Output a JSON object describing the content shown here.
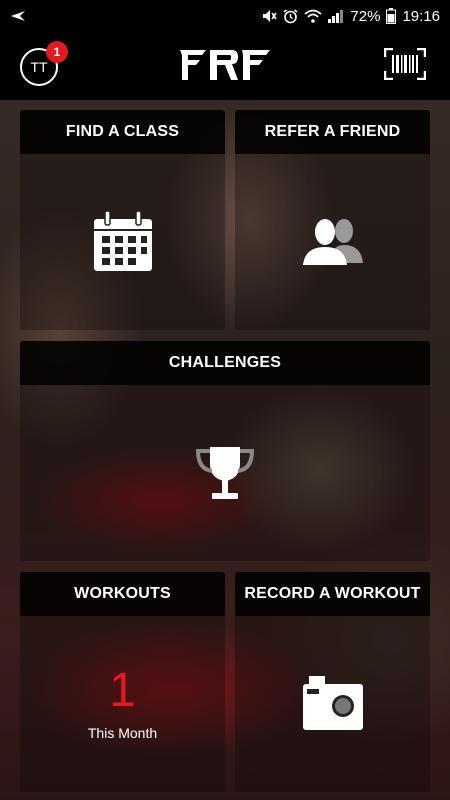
{
  "status_bar": {
    "battery": "72%",
    "time": "19:16",
    "icons": [
      "back-arrow-icon",
      "mute-icon",
      "alarm-icon",
      "wifi-icon",
      "signal-icon",
      "battery-icon"
    ]
  },
  "header": {
    "avatar_initials": "TT",
    "notification_count": "1",
    "logo": "FRF",
    "scan_icon": "barcode-scan-icon"
  },
  "tiles": {
    "find_class": {
      "title": "FIND A CLASS",
      "icon": "calendar-icon"
    },
    "refer_friend": {
      "title": "REFER A FRIEND",
      "icon": "users-icon"
    },
    "challenges": {
      "title": "CHALLENGES",
      "icon": "trophy-icon"
    },
    "workouts": {
      "title": "WORKOUTS",
      "count": "1",
      "period": "This Month"
    },
    "record_workout": {
      "title": "RECORD A WORKOUT",
      "icon": "camera-icon"
    }
  },
  "colors": {
    "accent": "#e11b22",
    "header_bg": "#000000"
  }
}
